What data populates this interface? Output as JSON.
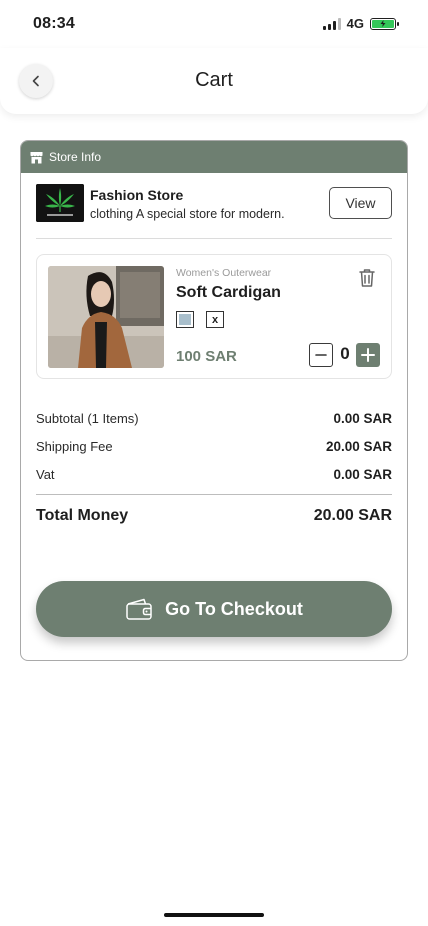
{
  "status_bar": {
    "time": "08:34",
    "network": "4G"
  },
  "header": {
    "title": "Cart",
    "back_icon": "chevron-left-icon"
  },
  "store_info": {
    "label": "Store Info",
    "icon": "storefront-icon",
    "name": "Fashion Store",
    "description": "clothing A special store for modern.",
    "view_label": "View"
  },
  "item": {
    "category": "Women's Outerwear",
    "title": "Soft Cardigan",
    "color_swatch": "#a9bfcc",
    "size": "x",
    "price": "100 SAR",
    "quantity": "0"
  },
  "summary": {
    "subtotal_label": "Subtotal (1 Items)",
    "subtotal_value": "0.00 SAR",
    "shipping_label": "Shipping Fee",
    "shipping_value": "20.00 SAR",
    "vat_label": "Vat",
    "vat_value": "0.00 SAR",
    "total_label": "Total Money",
    "total_value": "20.00 SAR"
  },
  "checkout": {
    "label": "Go To Checkout",
    "icon": "wallet-icon"
  },
  "colors": {
    "accent": "#6e7f71",
    "battery": "#34c759"
  }
}
